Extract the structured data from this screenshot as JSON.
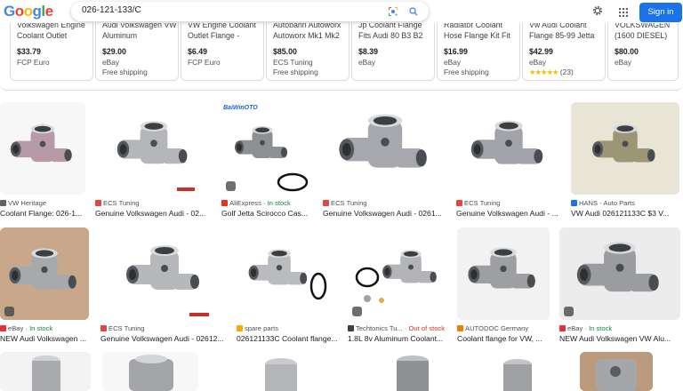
{
  "search": {
    "query": "026-121-133/C"
  },
  "header": {
    "signin_label": "Sign in",
    "logo": "Google"
  },
  "colors": {
    "accent": "#1a73e8",
    "price": "#202124",
    "in_stock": "#188038",
    "out_of_stock": "#d93025",
    "star": "#fbbc04"
  },
  "shopping": [
    {
      "title": "Volkswagen Engine Coolant Outlet",
      "price": "$33.79",
      "store": "FCP Euro",
      "extra": ""
    },
    {
      "title": "Audi Volkswagen VW Aluminum",
      "price": "$29.00",
      "store": "eBay",
      "extra": "Free shipping"
    },
    {
      "title": "VW Engine Coolant Outlet Flange -",
      "price": "$6.49",
      "store": "FCP Euro",
      "extra": ""
    },
    {
      "title": "Autobahn Autoworx Autoworx Mk1 Mk2",
      "price": "$85.00",
      "store": "ECS Tuning",
      "extra": "Free shipping"
    },
    {
      "title": "Jp Coolant Flange Fits Audi 80 B3 B2",
      "price": "$8.39",
      "store": "eBay",
      "extra": ""
    },
    {
      "title": "Radiator Coolant Hose Flange Kit Fit",
      "price": "$16.99",
      "store": "eBay",
      "extra": "Free shipping"
    },
    {
      "title": "Vw Audi Coolant Flange 85-99 Jetta",
      "price": "$42.99",
      "store": "eBay",
      "extra": "★★★★★ (23)",
      "rating": 5
    },
    {
      "title": "VOLKSWAGEN (1600 DIESEL)",
      "price": "$80.00",
      "store": "eBay",
      "extra": ""
    }
  ],
  "row1": [
    {
      "source": "VW Heritage",
      "stock": "",
      "title": "Coolant Flange: 026-1..."
    },
    {
      "source": "ECS Tuning",
      "stock": "",
      "title": "Genuine Volkswagen Audi - 02..."
    },
    {
      "source": "AliExpress",
      "stock": "In stock",
      "title": "Golf Jetta Scirocco Cas...",
      "watermark": "BaiWinOTO"
    },
    {
      "source": "ECS Tuning",
      "stock": "",
      "title": "Genuine Volkswagen Audi - 0261..."
    },
    {
      "source": "ECS Tuning",
      "stock": "",
      "title": "Genuine Volkswagen Audi - ..."
    },
    {
      "source": "HANS - Auto Parts",
      "stock": "",
      "title": "VW Audi 026121133C $3 V..."
    }
  ],
  "row2": [
    {
      "source": "eBay",
      "stock": "In stock",
      "title": "NEW Audi Volkswagen ..."
    },
    {
      "source": "ECS Tuning",
      "stock": "",
      "title": "Genuine Volkswagen Audi - 02612..."
    },
    {
      "source": "spare parts",
      "stock": "",
      "title": "026121133C Coolant flange..."
    },
    {
      "source": "Techtonics Tu...",
      "stock": "Out of stock",
      "title": "1.8L 8v Aluminum Coolant..."
    },
    {
      "source": "AUTODOC Germany",
      "stock": "",
      "title": "Coolant flange for VW, ..."
    },
    {
      "source": "eBay",
      "stock": "In stock",
      "title": "NEW Audi Volkswagen VW Alu..."
    }
  ]
}
